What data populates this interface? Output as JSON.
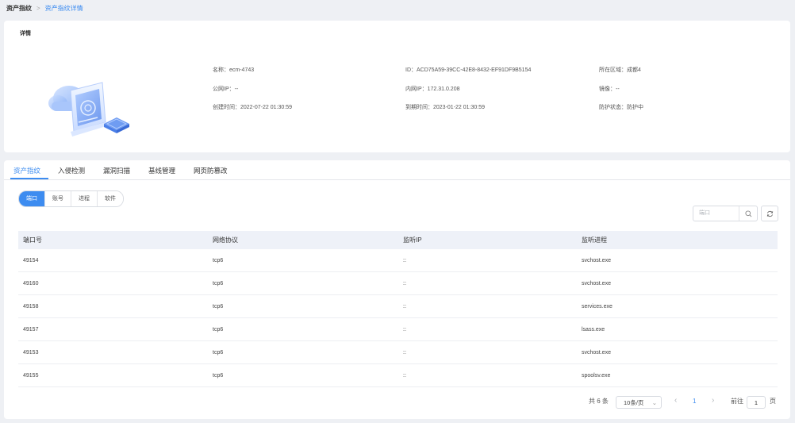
{
  "breadcrumb": {
    "root": "资产指纹",
    "separator": ">",
    "current": "资产指纹详情"
  },
  "detail": {
    "title": "详情",
    "fields": {
      "name": "名称：ecm-4743",
      "id": "ID：ACD75A59-39CC-42E8-8432-EF91DF9B5154",
      "region": "所在区域：成都4",
      "public_ip": "公网IP：--",
      "private_ip": "内网IP：172.31.0.208",
      "image": "镜像：--",
      "created": "创建时间：2022-07-22 01:30:59",
      "expires": "到期时间：2023-01-22 01:30:59",
      "protection": "防护状态：防护中"
    }
  },
  "tabs": [
    "资产指纹",
    "入侵检测",
    "漏洞扫描",
    "基线管理",
    "网页防篡改"
  ],
  "subtabs": [
    "端口",
    "账号",
    "进程",
    "软件"
  ],
  "search": {
    "placeholder": "端口"
  },
  "table": {
    "headers": [
      "端口号",
      "网络协议",
      "监听IP",
      "监听进程"
    ],
    "rows": [
      [
        "49154",
        "tcp6",
        "::",
        "svchost.exe"
      ],
      [
        "49160",
        "tcp6",
        "::",
        "svchost.exe"
      ],
      [
        "49158",
        "tcp6",
        "::",
        "services.exe"
      ],
      [
        "49157",
        "tcp6",
        "::",
        "lsass.exe"
      ],
      [
        "49153",
        "tcp6",
        "::",
        "svchost.exe"
      ],
      [
        "49155",
        "tcp6",
        "::",
        "spoolsv.exe"
      ]
    ]
  },
  "pagination": {
    "total": "共 6 条",
    "page_size": "10条/页",
    "prev": "‹",
    "current_page": "1",
    "next": "›",
    "goto_label": "前往",
    "goto_value": "1",
    "page_suffix": "页"
  },
  "colors": {
    "accent": "#3d8cf0",
    "header_bg": "#eef1f8",
    "page_bg": "#eef0f4"
  }
}
